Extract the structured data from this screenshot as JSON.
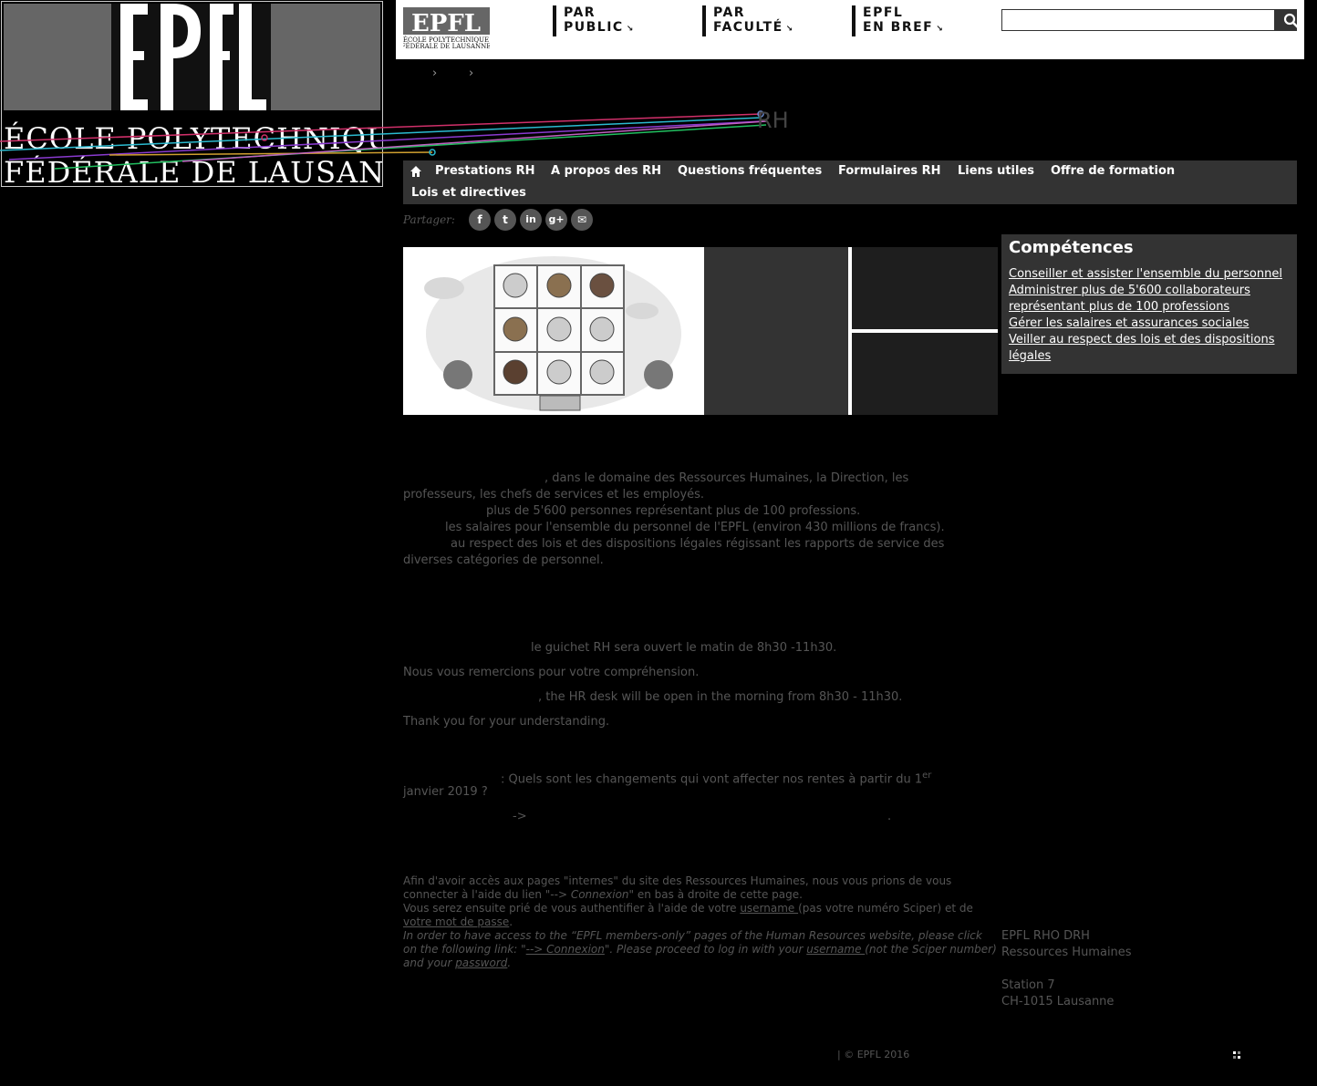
{
  "banner": {
    "logo_text": "EPFL",
    "line1": "ÉCOLE POLYTECHNIQUE",
    "line2": "FÉDÉRALE DE LAUSANNE"
  },
  "header": {
    "logo_text": "EPFL",
    "logo_sub1": "ÉCOLE POLYTECHNIQUE",
    "logo_sub2": "FÉDÉRALE DE LAUSANNE",
    "nav": [
      {
        "line1": "PAR",
        "line2": "PUBLIC"
      },
      {
        "line1": "PAR",
        "line2": "FACULTÉ"
      },
      {
        "line1": "EPFL",
        "line2": "EN BREF"
      }
    ],
    "search_value": "",
    "search_icon": "search-icon"
  },
  "breadcrumb": {
    "sep": "›"
  },
  "site_title": "RH",
  "menu": {
    "home_icon": "home-icon",
    "items": [
      "Prestations RH",
      "A propos des RH",
      "Questions fréquentes",
      "Formulaires RH",
      "Liens utiles",
      "Offre de formation",
      "Lois et directives"
    ]
  },
  "share": {
    "label": "Partager:",
    "buttons": [
      "f",
      "t",
      "in",
      "g+",
      "✉"
    ]
  },
  "competences": {
    "title": "Compétences",
    "items": [
      "Conseiller et assister l'ensemble du personnel",
      "Administrer plus de 5'600 collaborateurs représentant plus de 100 professions",
      "Gérer les salaires et assurances sociales",
      "Veiller au respect des lois et des dispositions légales"
    ]
  },
  "intro": {
    "l1": ", dans le domaine des Ressources Humaines, la Direction, les",
    "l2": "professeurs, les chefs de services et les employés.",
    "l3": "plus de 5'600 personnes représentant plus de 100 professions.",
    "l4": "les salaires pour l'ensemble du personnel de l'EPFL (environ 430 millions de francs).",
    "l5": "au respect des lois et des dispositions légales régissant les rapports de service des",
    "l6": "diverses catégories de personnel."
  },
  "notice": {
    "fr": "le guichet RH sera ouvert le matin de 8h30 -11h30.",
    "fr_thanks": "Nous vous remercions pour votre compréhension.",
    "en": ", the HR desk will be open in the morning from 8h30 - 11h30.",
    "en_thanks": "Thank you for your understanding."
  },
  "pension": {
    "l1": ": Quels sont les changements qui vont affecter nos rentes à partir du 1",
    "sup": "er",
    "l2": "janvier 2019 ?",
    "arrow": "->",
    "dot": "."
  },
  "login": {
    "fr1": "Afin d'avoir accès aux pages \"internes\" du site des Ressources Humaines, nous vous prions de vous",
    "fr2a": "connecter à l'aide du lien \"",
    "fr2b": "--> Connexion",
    "fr2c": "\" en bas à droite de cette page.",
    "fr3a": "Vous serez ensuite prié de vous authentifier à l'aide de votre ",
    "fr3b": "username ",
    "fr3c": "(pas votre numéro Sciper) et de",
    "fr4": "votre mot de passe",
    "fr4b": ".",
    "en1": "In order to have access to the “EPFL members-only” pages of the Human Resources website, please click",
    "en2a": "on the following link: \"",
    "en2b": "--> Connexion",
    "en2c": "\". Please proceed to log in with your ",
    "en2d": "username ",
    "en2e": "(not the Sciper number)",
    "en3a": "and your ",
    "en3b": "password",
    "en3c": "."
  },
  "address": {
    "l1": "EPFL RHO DRH",
    "l2": "Ressources Humaines",
    "l3": "Station 7",
    "l4": "CH-1015 Lausanne"
  },
  "footer": {
    "copyright": "| © EPFL 2016"
  }
}
